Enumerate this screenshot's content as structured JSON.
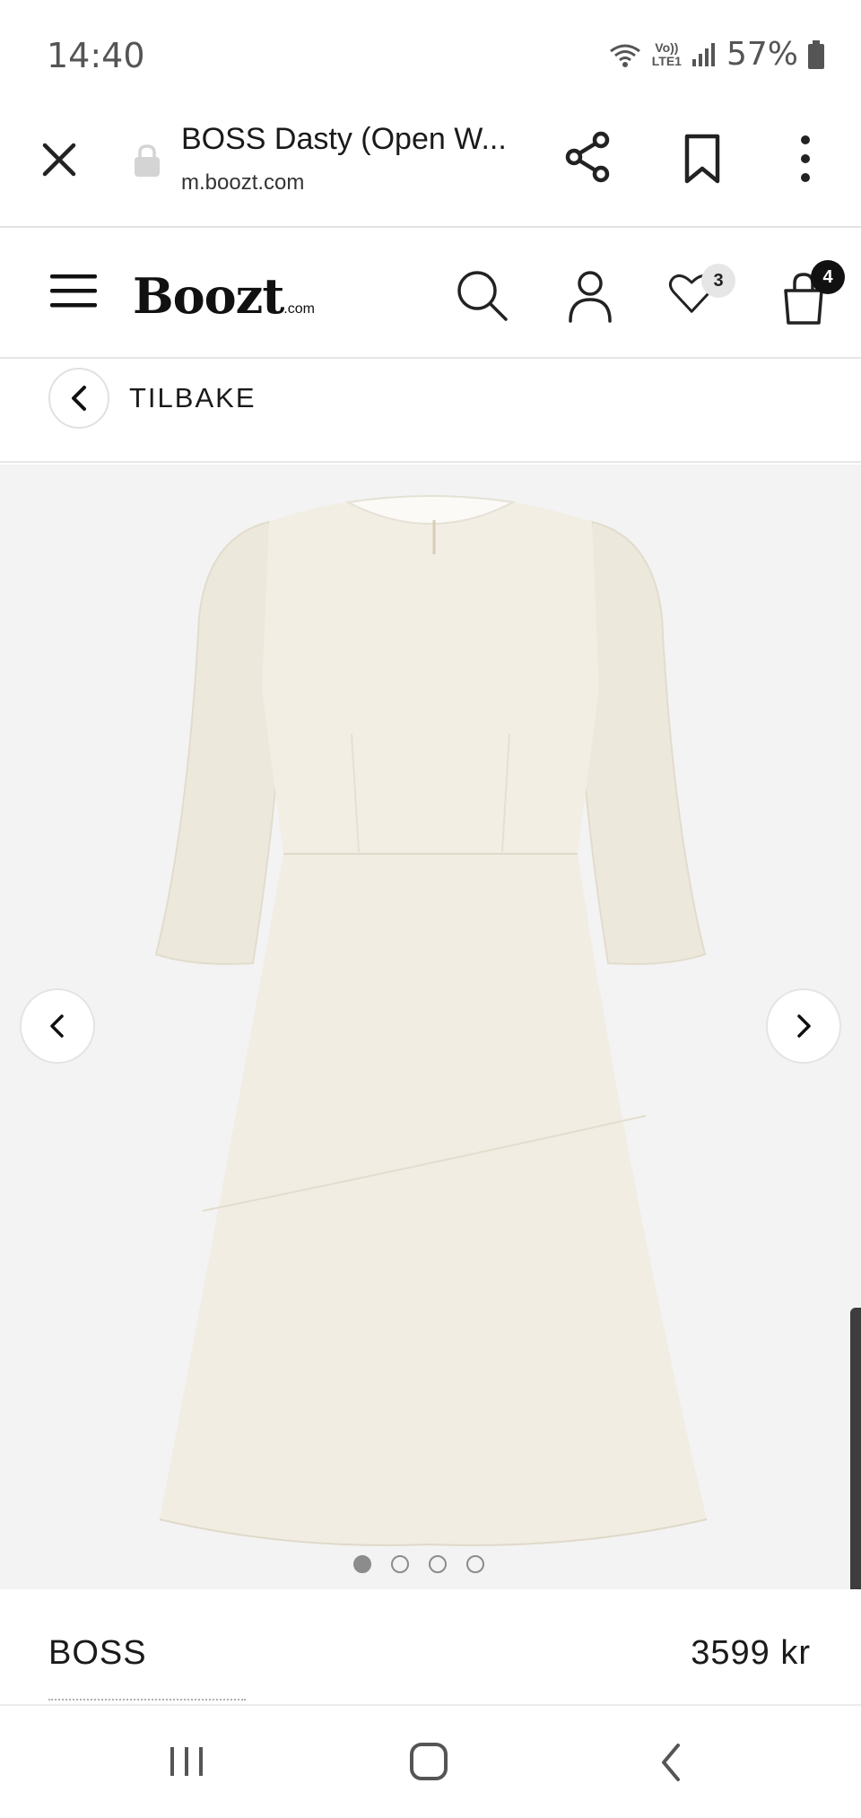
{
  "status_bar": {
    "time": "14:40",
    "network_top": "Vo))",
    "network_bottom": "LTE1",
    "battery": "57%"
  },
  "browser": {
    "title": "BOSS Dasty (Open W...",
    "url": "m.boozt.com",
    "icons": [
      "close-icon",
      "lock-icon",
      "share-icon",
      "bookmark-icon",
      "more-vertical-icon"
    ]
  },
  "site_header": {
    "logo": "Boozt",
    "logo_suffix": ".com",
    "wishlist_count": "3",
    "cart_count": "4",
    "icons": [
      "menu-icon",
      "search-icon",
      "account-icon",
      "heart-icon",
      "bag-icon"
    ]
  },
  "nav": {
    "back_label": "TILBAKE"
  },
  "gallery": {
    "image_count": 4,
    "active_index": 0,
    "background": "#f3f3f3",
    "garment_color": "#f1ede3"
  },
  "product": {
    "brand": "BOSS",
    "price": "3599 kr"
  },
  "colors": {
    "text": "#1a1a1a",
    "cart_badge": "#111111",
    "wishlist_badge": "#e6e6e6"
  }
}
